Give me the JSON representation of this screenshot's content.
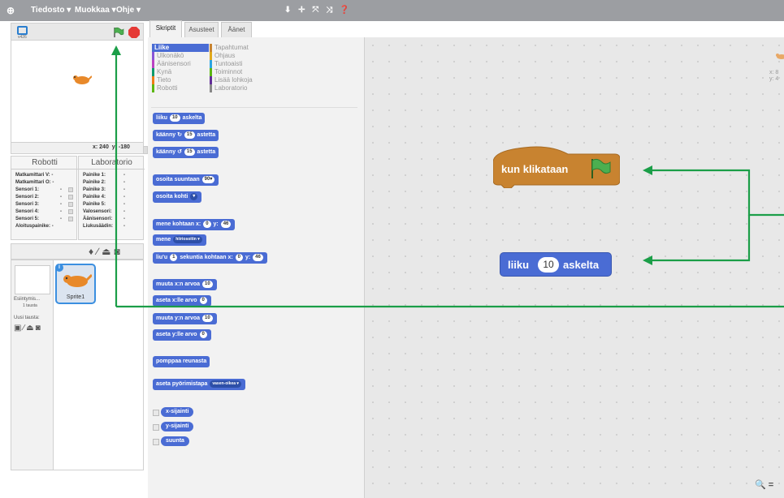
{
  "menu": {
    "file": "Tiedosto ▾",
    "edit": "Muokkaa ▾",
    "help": "Ohje ▾",
    "tools": "⬇ ✛ ⤧ ⤨ ❓"
  },
  "stage": {
    "version": "v426",
    "coords": "x: 240  y: -180"
  },
  "robot_panel": {
    "title": "Robotti",
    "rows": [
      {
        "label": "Matkamittari V:",
        "value": "-"
      },
      {
        "label": "Matkamittari O:",
        "value": "-"
      },
      {
        "label": "Sensori 1:",
        "value": "-"
      },
      {
        "label": "Sensori 2:",
        "value": "-"
      },
      {
        "label": "Sensori 3:",
        "value": "-"
      },
      {
        "label": "Sensori 4:",
        "value": "-"
      },
      {
        "label": "Sensori 5:",
        "value": "-"
      },
      {
        "label": "Aloituspainike:",
        "value": "-"
      }
    ]
  },
  "lab_panel": {
    "title": "Laboratorio",
    "rows": [
      {
        "label": "Painike 1:",
        "value": "-"
      },
      {
        "label": "Painike 2:",
        "value": "-"
      },
      {
        "label": "Painike 3:",
        "value": "-"
      },
      {
        "label": "Painike 4:",
        "value": "-"
      },
      {
        "label": "Painike 5:",
        "value": "-"
      },
      {
        "label": "Valosensori:",
        "value": "-"
      },
      {
        "label": "Äänisensori:",
        "value": "-"
      },
      {
        "label": "Liukusäädin:",
        "value": "-"
      }
    ]
  },
  "sprites": {
    "stage_label": "Esiintymis...",
    "stage_sub": "1 tausta",
    "new_backdrop": "Uusi tausta:",
    "sprite_name": "Sprite1"
  },
  "tabs": [
    "Skriptit",
    "Asusteet",
    "Äänet"
  ],
  "categories": [
    {
      "name": "Liike",
      "color": "#4a6cd4",
      "active": true
    },
    {
      "name": "Tapahtumat",
      "color": "#c88330"
    },
    {
      "name": "Ulkonäkö",
      "color": "#8a55d7"
    },
    {
      "name": "Ohjaus",
      "color": "#e1a91a"
    },
    {
      "name": "Äänisensori",
      "color": "#bb42c3"
    },
    {
      "name": "Tuntoaisti",
      "color": "#2ca5e2"
    },
    {
      "name": "Kynä",
      "color": "#0e9a6c"
    },
    {
      "name": "Toiminnot",
      "color": "#5cb712"
    },
    {
      "name": "Tieto",
      "color": "#ee7d16"
    },
    {
      "name": "Lisää lohkoja",
      "color": "#632d99"
    },
    {
      "name": "Robotti",
      "color": "#5cb712"
    },
    {
      "name": "Laboratorio",
      "color": "#888888"
    }
  ],
  "blocks": {
    "b1": [
      "liiku",
      "10",
      "askelta"
    ],
    "b2": [
      "käänny",
      "↻",
      "15",
      "astetta"
    ],
    "b3": [
      "käänny",
      "↺",
      "15",
      "astetta"
    ],
    "b4": [
      "osoita suuntaan",
      "90▾"
    ],
    "b5": [
      "osoita kohti",
      "▾"
    ],
    "b6": [
      "mene kohtaan x:",
      "0",
      "y:",
      "46"
    ],
    "b7": [
      "mene",
      "hiiriosoitin ▾"
    ],
    "b8": [
      "liu'u",
      "1",
      "sekuntia kohtaan x:",
      "0",
      "y:",
      "46"
    ],
    "b9": [
      "muuta x:n arvoa",
      "10"
    ],
    "b10": [
      "aseta x:lle arvo",
      "0"
    ],
    "b11": [
      "muuta y:n arvoa",
      "10"
    ],
    "b12": [
      "aseta y:lle arvo",
      "0"
    ],
    "b13": [
      "pomppaa reunasta"
    ],
    "b14": [
      "aseta pyörimistapa",
      "vasen-oikea ▾"
    ],
    "r1": "x-sijainti",
    "r2": "y-sijainti",
    "r3": "suunta"
  },
  "script": {
    "hat_label": "kun klikataan",
    "move_label": "liiku",
    "move_value": "10",
    "move_unit": "askelta",
    "sprite_xy": "x: 8\ny: 4"
  },
  "colors": {
    "motion": "#4a6cd4",
    "events": "#c88330",
    "arrow": "#1b9e48"
  }
}
